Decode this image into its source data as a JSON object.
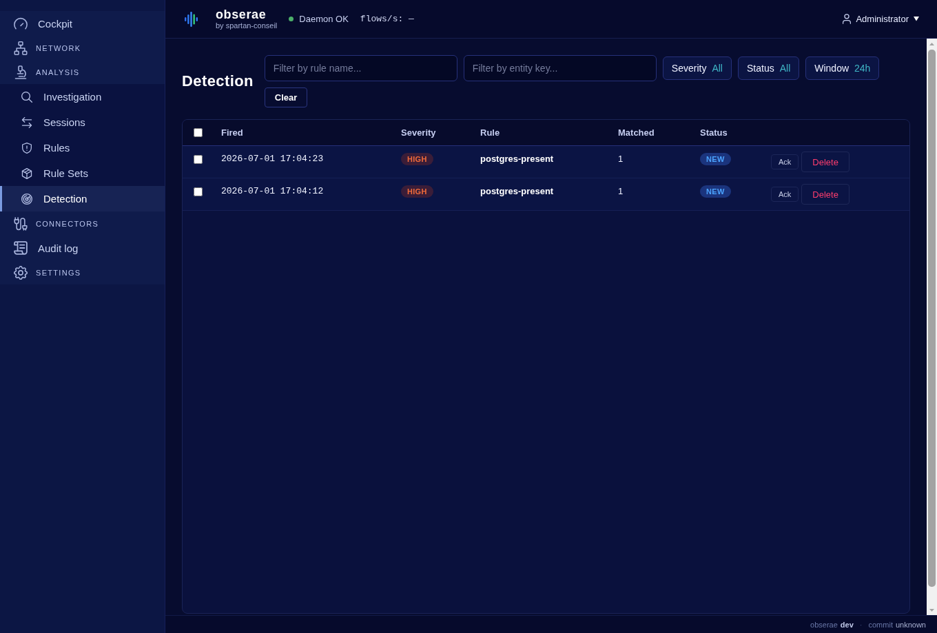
{
  "sidebar": {
    "items": [
      {
        "kind": "link",
        "label": "Cockpit",
        "selected": false
      },
      {
        "kind": "section",
        "label": "NETWORK",
        "selected": false
      },
      {
        "kind": "section",
        "label": "ANALYSIS",
        "selected": false,
        "children": [
          {
            "label": "Investigation",
            "selected": false
          },
          {
            "label": "Sessions",
            "selected": false
          },
          {
            "label": "Rules",
            "selected": false
          },
          {
            "label": "Rule Sets",
            "selected": false
          },
          {
            "label": "Detection",
            "selected": true
          }
        ]
      },
      {
        "kind": "section",
        "label": "CONNECTORS",
        "selected": false
      },
      {
        "kind": "link",
        "label": "Audit log",
        "selected": false
      },
      {
        "kind": "section",
        "label": "SETTINGS",
        "selected": false
      }
    ]
  },
  "header": {
    "app_name": "obserae",
    "byline": "by spartan-conseil",
    "daemon": {
      "ok": true,
      "label": "Daemon OK"
    },
    "flow_rate": "flows/s: —",
    "user": "Administrator"
  },
  "page": {
    "title": "Detection",
    "filters": [
      {
        "kind": "text",
        "placeholder": "Filter by rule name..."
      },
      {
        "kind": "text",
        "placeholder": "Filter by entity key..."
      },
      {
        "kind": "select",
        "label": "Severity",
        "value": "All"
      },
      {
        "kind": "select",
        "label": "Status",
        "value": "All"
      },
      {
        "kind": "select",
        "label": "Window",
        "value": "24h"
      }
    ],
    "clear_button": "Clear"
  },
  "table": {
    "select_all": {
      "checked": false
    },
    "columns": [
      "Fired",
      "Severity",
      "Rule",
      "Matched",
      "Status"
    ],
    "rows": [
      {
        "checked": false,
        "fired": "2026-07-01 17:04:23",
        "severity": "HIGH",
        "rule": "postgres-present",
        "matched": "1",
        "status": "NEW",
        "actions": [
          {
            "kind": "ack",
            "label": "Ack"
          },
          {
            "kind": "delete",
            "label": "Delete"
          }
        ]
      },
      {
        "checked": false,
        "fired": "2026-07-01 17:04:12",
        "severity": "HIGH",
        "rule": "postgres-present",
        "matched": "1",
        "status": "NEW",
        "actions": [
          {
            "kind": "ack",
            "label": "Ack"
          },
          {
            "kind": "delete",
            "label": "Delete"
          }
        ]
      }
    ]
  },
  "footer": {
    "app_label": "obserae",
    "version": "dev",
    "separator": "·",
    "commit_label": "commit",
    "commit": "unknown"
  }
}
